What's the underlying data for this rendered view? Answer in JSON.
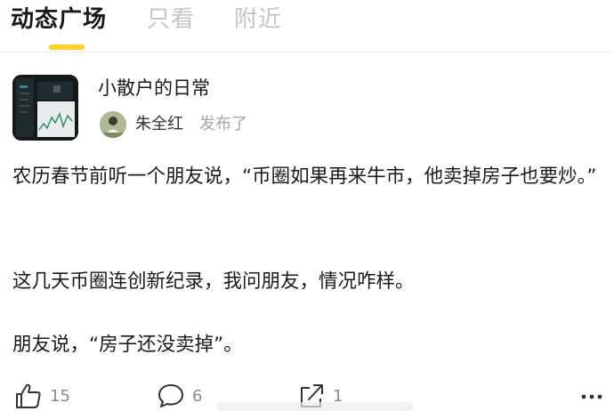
{
  "tabs": {
    "items": [
      {
        "label": "动态广场",
        "active": true
      },
      {
        "label": "只看",
        "active": false
      },
      {
        "label": "附近",
        "active": false
      }
    ],
    "indicator_color": "#ffd21f"
  },
  "post": {
    "group_name": "小散户的日常",
    "group_thumbnail_icon": "stock-chart-thumbnail",
    "author_name": "朱全红",
    "action_text": "发布了",
    "paragraphs": [
      "农历春节前听一个朋友说，“币圈如果再来牛市，他卖掉房子也要炒。”",
      "这几天币圈连创新纪录，我问朋友，情况咋样。",
      "朋友说，“房子还没卖掉”。"
    ]
  },
  "actions": {
    "like": {
      "icon": "thumbs-up-icon",
      "count": "15"
    },
    "comment": {
      "icon": "comment-bubble-icon",
      "count": "6"
    },
    "share": {
      "icon": "share-icon",
      "count": "1"
    },
    "more": {
      "icon": "more-icon"
    }
  },
  "colors": {
    "accent": "#ffd21f",
    "muted_text": "#a6a6a6",
    "inactive_tab": "#c4c4c4"
  }
}
